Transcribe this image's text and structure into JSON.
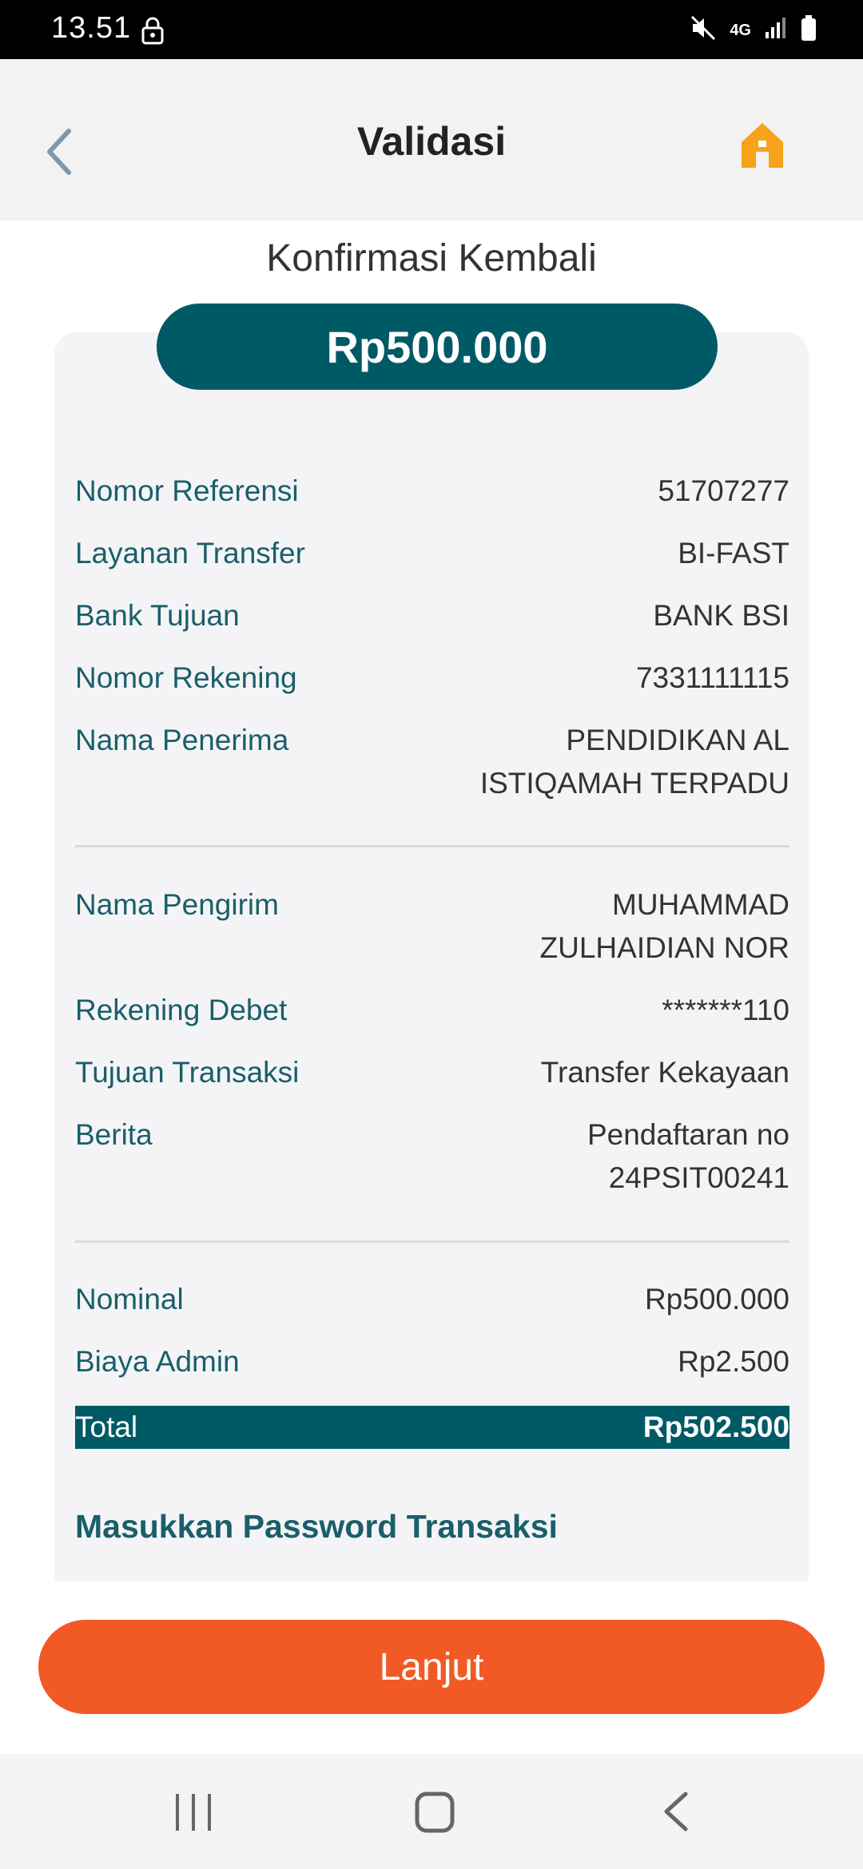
{
  "status_bar": {
    "time": "13.51",
    "network": "4G",
    "icons": [
      "lock-icon",
      "mute-icon",
      "signal-icon",
      "battery-icon"
    ]
  },
  "header": {
    "title": "Validasi",
    "back_icon": "chevron-left-icon",
    "home_icon": "home-icon",
    "home_color": "#f7a21b"
  },
  "confirm": {
    "title": "Konfirmasi Kembali",
    "amount": "Rp500.000",
    "accent_color": "#005a66"
  },
  "details": {
    "nomor_referensi": {
      "label": "Nomor Referensi",
      "value": "51707277"
    },
    "layanan_transfer": {
      "label": "Layanan Transfer",
      "value": "BI-FAST"
    },
    "bank_tujuan": {
      "label": "Bank Tujuan",
      "value": "BANK BSI"
    },
    "nomor_rekening": {
      "label": "Nomor Rekening",
      "value": "7331111115"
    },
    "nama_penerima": {
      "label": "Nama Penerima",
      "value_line1": "PENDIDIKAN AL",
      "value_line2": "ISTIQAMAH TERPADU"
    },
    "nama_pengirim": {
      "label": "Nama Pengirim",
      "value_line1": "MUHAMMAD",
      "value_line2": "ZULHAIDIAN NOR"
    },
    "rekening_debet": {
      "label": "Rekening Debet",
      "value": "*******110"
    },
    "tujuan_transaksi": {
      "label": "Tujuan Transaksi",
      "value": "Transfer Kekayaan"
    },
    "berita": {
      "label": "Berita",
      "value_line1": "Pendaftaran no",
      "value_line2": "24PSIT00241"
    },
    "nominal": {
      "label": "Nominal",
      "value": "Rp500.000"
    },
    "biaya_admin": {
      "label": "Biaya Admin",
      "value": "Rp2.500"
    },
    "total": {
      "label": "Total",
      "value": "Rp502.500"
    }
  },
  "password": {
    "label": "Masukkan Password Transaksi"
  },
  "actions": {
    "next_label": "Lanjut",
    "next_color": "#f15a24"
  },
  "nav": {
    "items": [
      "recent-apps-icon",
      "home-nav-icon",
      "back-nav-icon"
    ]
  }
}
